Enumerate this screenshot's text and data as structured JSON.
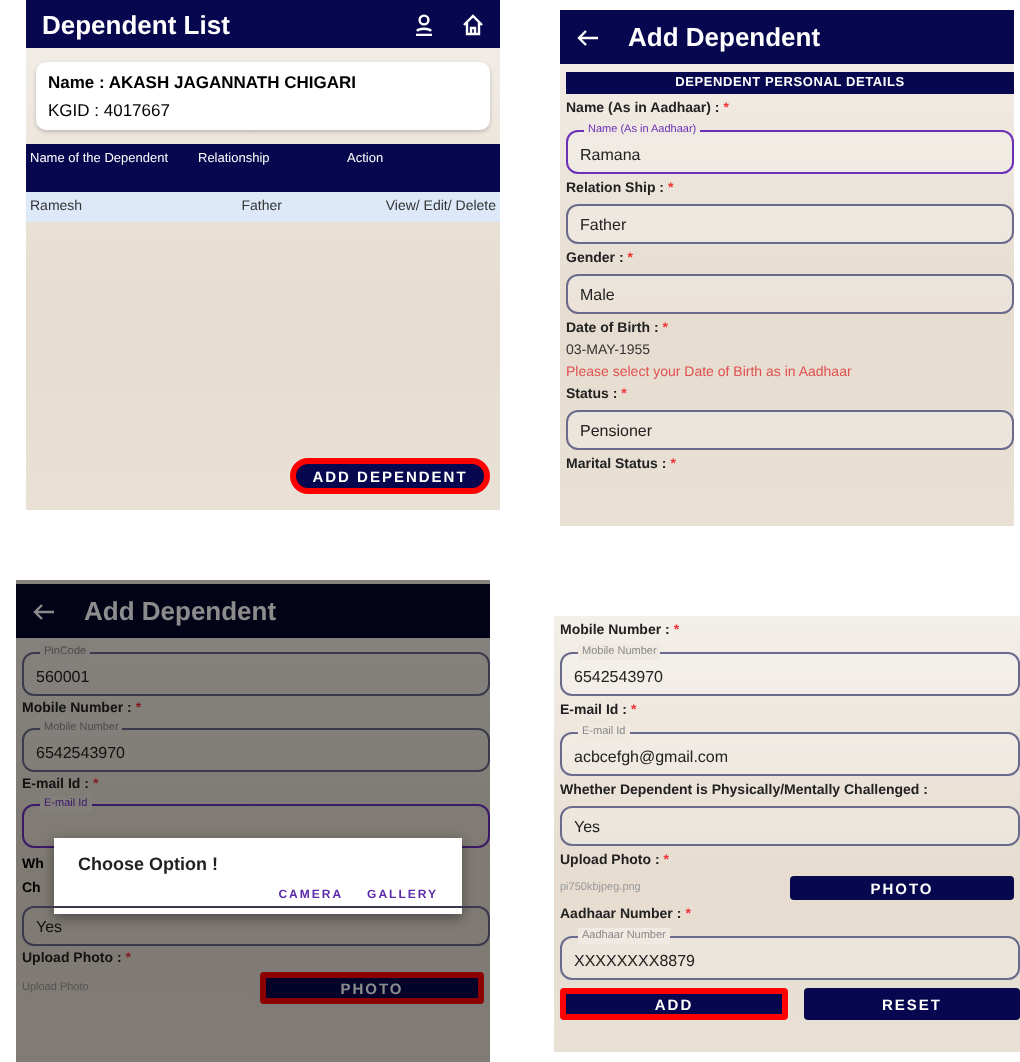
{
  "panels": [
    {
      "kind": "list",
      "header": {
        "title": "Dependent List",
        "icons": true
      },
      "card": {
        "name": "Name : AKASH JAGANNATH CHIGARI",
        "kgid": "KGID : 4017667"
      },
      "table": {
        "columns": [
          "Name of the Dependent",
          "Relationship",
          "Action"
        ],
        "rows": [
          [
            "Ramesh",
            "Father",
            "View/ Edit/ Delete"
          ]
        ]
      },
      "button": {
        "label": "ADD DEPENDENT",
        "highlighted": true
      }
    },
    {
      "kind": "form",
      "header": {
        "title": "Add Dependent",
        "back": true
      },
      "section_title": "DEPENDENT PERSONAL DETAILS",
      "items": [
        {
          "kind": "label",
          "text": "Name (As in Aadhaar) :",
          "mark": "*"
        },
        {
          "kind": "field",
          "legend": "Name (As in Aadhaar)",
          "value": "Ramana",
          "focused": true
        },
        {
          "kind": "label",
          "text": "Relation Ship :",
          "mark": "*"
        },
        {
          "kind": "field",
          "value": "Father",
          "focused": false
        },
        {
          "kind": "label",
          "text": "Gender :",
          "mark": "*"
        },
        {
          "kind": "field",
          "value": "Male",
          "focused": false
        },
        {
          "kind": "label",
          "text": "Date of Birth :",
          "mark": "*"
        },
        {
          "kind": "value",
          "text": "03-MAY-1955"
        },
        {
          "kind": "note",
          "text": "Please select your Date of Birth as in Aadhaar"
        },
        {
          "kind": "label",
          "text": "Status :",
          "mark": "*"
        },
        {
          "kind": "field",
          "value": "Pensioner",
          "focused": false
        },
        {
          "kind": "label",
          "text": "Marital Status :",
          "mark": "*"
        }
      ]
    },
    {
      "kind": "form",
      "dimmed": true,
      "header": {
        "title": "Add Dependent",
        "back": true
      },
      "items": [
        {
          "kind": "field",
          "legend": "PinCode",
          "value": "560001",
          "focused": false
        },
        {
          "kind": "label",
          "text": "Mobile Number :",
          "mark": "*"
        },
        {
          "kind": "field",
          "legend": "Mobile Number",
          "value": "6542543970",
          "focused": false
        },
        {
          "kind": "label",
          "text": "E-mail Id :",
          "mark": "*"
        },
        {
          "kind": "field",
          "legend": "E-mail Id",
          "focused": true
        },
        {
          "kind": "covered",
          "lines": [
            "Wh",
            "Ch"
          ],
          "dialog": {
            "title": "Choose Option !",
            "actions": [
              "CAMERA",
              "GALLERY"
            ]
          }
        },
        {
          "kind": "field",
          "value": "Yes",
          "focused": false
        },
        {
          "kind": "label",
          "text": "Upload Photo :",
          "mark": "*"
        },
        {
          "kind": "upload",
          "placeholder": "Upload Photo",
          "button": {
            "label": "PHOTO",
            "highlighted": true
          }
        }
      ]
    },
    {
      "kind": "form",
      "items": [
        {
          "kind": "label",
          "text": "Mobile Number :",
          "mark": "*"
        },
        {
          "kind": "field",
          "legend": "Mobile Number",
          "value": "6542543970",
          "focused": false
        },
        {
          "kind": "label",
          "text": "E-mail Id :",
          "mark": "*"
        },
        {
          "kind": "field",
          "legend": "E-mail Id",
          "value": "acbcefgh@gmail.com",
          "focused": false
        },
        {
          "kind": "label",
          "text": "Whether Dependent is Physically/Mentally Challenged :"
        },
        {
          "kind": "field",
          "value": "Yes",
          "focused": false
        },
        {
          "kind": "label",
          "text": "Upload Photo :",
          "mark": "*"
        },
        {
          "kind": "upload",
          "filename": "pi750kbjpeg.png",
          "button": {
            "label": "PHOTO",
            "highlighted": false
          }
        },
        {
          "kind": "label",
          "text": "Aadhaar Number :",
          "mark": "*"
        },
        {
          "kind": "field",
          "legend": "Aadhaar Number",
          "value": "XXXXXXXX8879",
          "focused": false
        },
        {
          "kind": "buttons",
          "buttons": [
            {
              "label": "ADD",
              "highlighted": true
            },
            {
              "label": "RESET",
              "highlighted": false
            }
          ]
        }
      ]
    }
  ]
}
